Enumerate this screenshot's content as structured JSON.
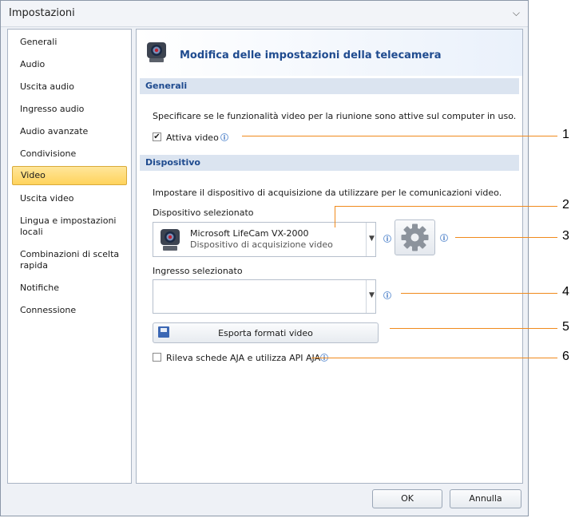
{
  "window": {
    "title": "Impostazioni",
    "close_glyph": "⌵"
  },
  "sidebar": {
    "items": [
      {
        "label": "Generali"
      },
      {
        "label": "Audio"
      },
      {
        "label": "Uscita audio"
      },
      {
        "label": "Ingresso audio"
      },
      {
        "label": "Audio avanzate"
      },
      {
        "label": "Condivisione"
      },
      {
        "label": "Video"
      },
      {
        "label": "Uscita video"
      },
      {
        "label": "Lingua e impostazioni locali"
      },
      {
        "label": "Combinazioni di scelta rapida"
      },
      {
        "label": "Notifiche"
      },
      {
        "label": "Connessione"
      }
    ],
    "selected": "Video"
  },
  "header": {
    "title": "Modifica delle impostazioni della telecamera",
    "icon": "webcam-icon"
  },
  "sections": {
    "general": {
      "title": "Generali",
      "description": "Specificare se le funzionalità video per la riunione sono attive sul computer in uso.",
      "enable_video_label": "Attiva video",
      "enable_video_checked": true
    },
    "device": {
      "title": "Dispositivo",
      "description": "Impostare il dispositivo di acquisizione da utilizzare per le comunicazioni video.",
      "selected_device_label": "Dispositivo selezionato",
      "device_name": "Microsoft LifeCam VX-2000",
      "device_desc": "Dispositivo di acquisizione video",
      "selected_input_label": "Ingresso selezionato",
      "selected_input_value": "",
      "export_button": "Esporta formati video",
      "aja_label": "Rileva schede AJA e utilizza API AJA",
      "aja_checked": false
    }
  },
  "footer": {
    "ok_label": "OK",
    "cancel_label": "Annulla"
  },
  "callouts": [
    "1",
    "2",
    "3",
    "4",
    "5",
    "6"
  ],
  "colors": {
    "accent": "#1f4b8f",
    "selection": "#ffd35c",
    "callout_line": "#f08a1c",
    "section_bar": "#dbe4f0"
  }
}
